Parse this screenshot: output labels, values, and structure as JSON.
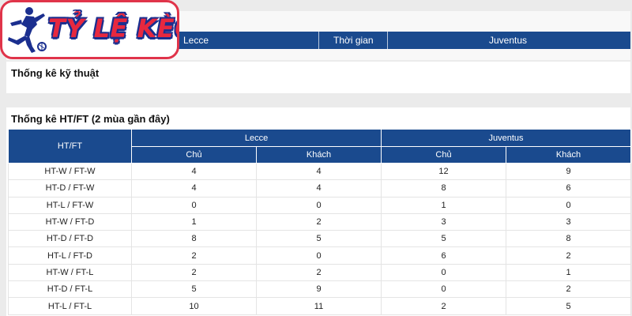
{
  "logo": {
    "text": "TỶ LỆ KÈO"
  },
  "match_header": {
    "home_team": "Lecce",
    "time_label": "Thời gian",
    "away_team": "Juventus"
  },
  "technical": {
    "title": "Thống kê kỹ thuật"
  },
  "htft": {
    "title": "Thống kê HT/FT (2 mùa gần đây)",
    "col_label": "HT/FT",
    "home_team": "Lecce",
    "away_team": "Juventus",
    "sub_headers": [
      "Chủ",
      "Khách",
      "Chủ",
      "Khách"
    ],
    "rows": [
      {
        "label": "HT-W / FT-W",
        "values": [
          "4",
          "4",
          "12",
          "9"
        ]
      },
      {
        "label": "HT-D / FT-W",
        "values": [
          "4",
          "4",
          "8",
          "6"
        ]
      },
      {
        "label": "HT-L / FT-W",
        "values": [
          "0",
          "0",
          "1",
          "0"
        ]
      },
      {
        "label": "HT-W / FT-D",
        "values": [
          "1",
          "2",
          "3",
          "3"
        ]
      },
      {
        "label": "HT-D / FT-D",
        "values": [
          "8",
          "5",
          "5",
          "8"
        ]
      },
      {
        "label": "HT-L / FT-D",
        "values": [
          "2",
          "0",
          "6",
          "2"
        ]
      },
      {
        "label": "HT-W / FT-L",
        "values": [
          "2",
          "2",
          "0",
          "1"
        ]
      },
      {
        "label": "HT-D / FT-L",
        "values": [
          "5",
          "9",
          "0",
          "2"
        ]
      },
      {
        "label": "HT-L / FT-L",
        "values": [
          "10",
          "11",
          "2",
          "5"
        ]
      }
    ]
  },
  "colors": {
    "header_blue": "#1a4a8e",
    "logo_red": "#e7283f",
    "logo_outline_blue": "#1b2f8f"
  },
  "icons": [
    "soccer-player-icon"
  ]
}
